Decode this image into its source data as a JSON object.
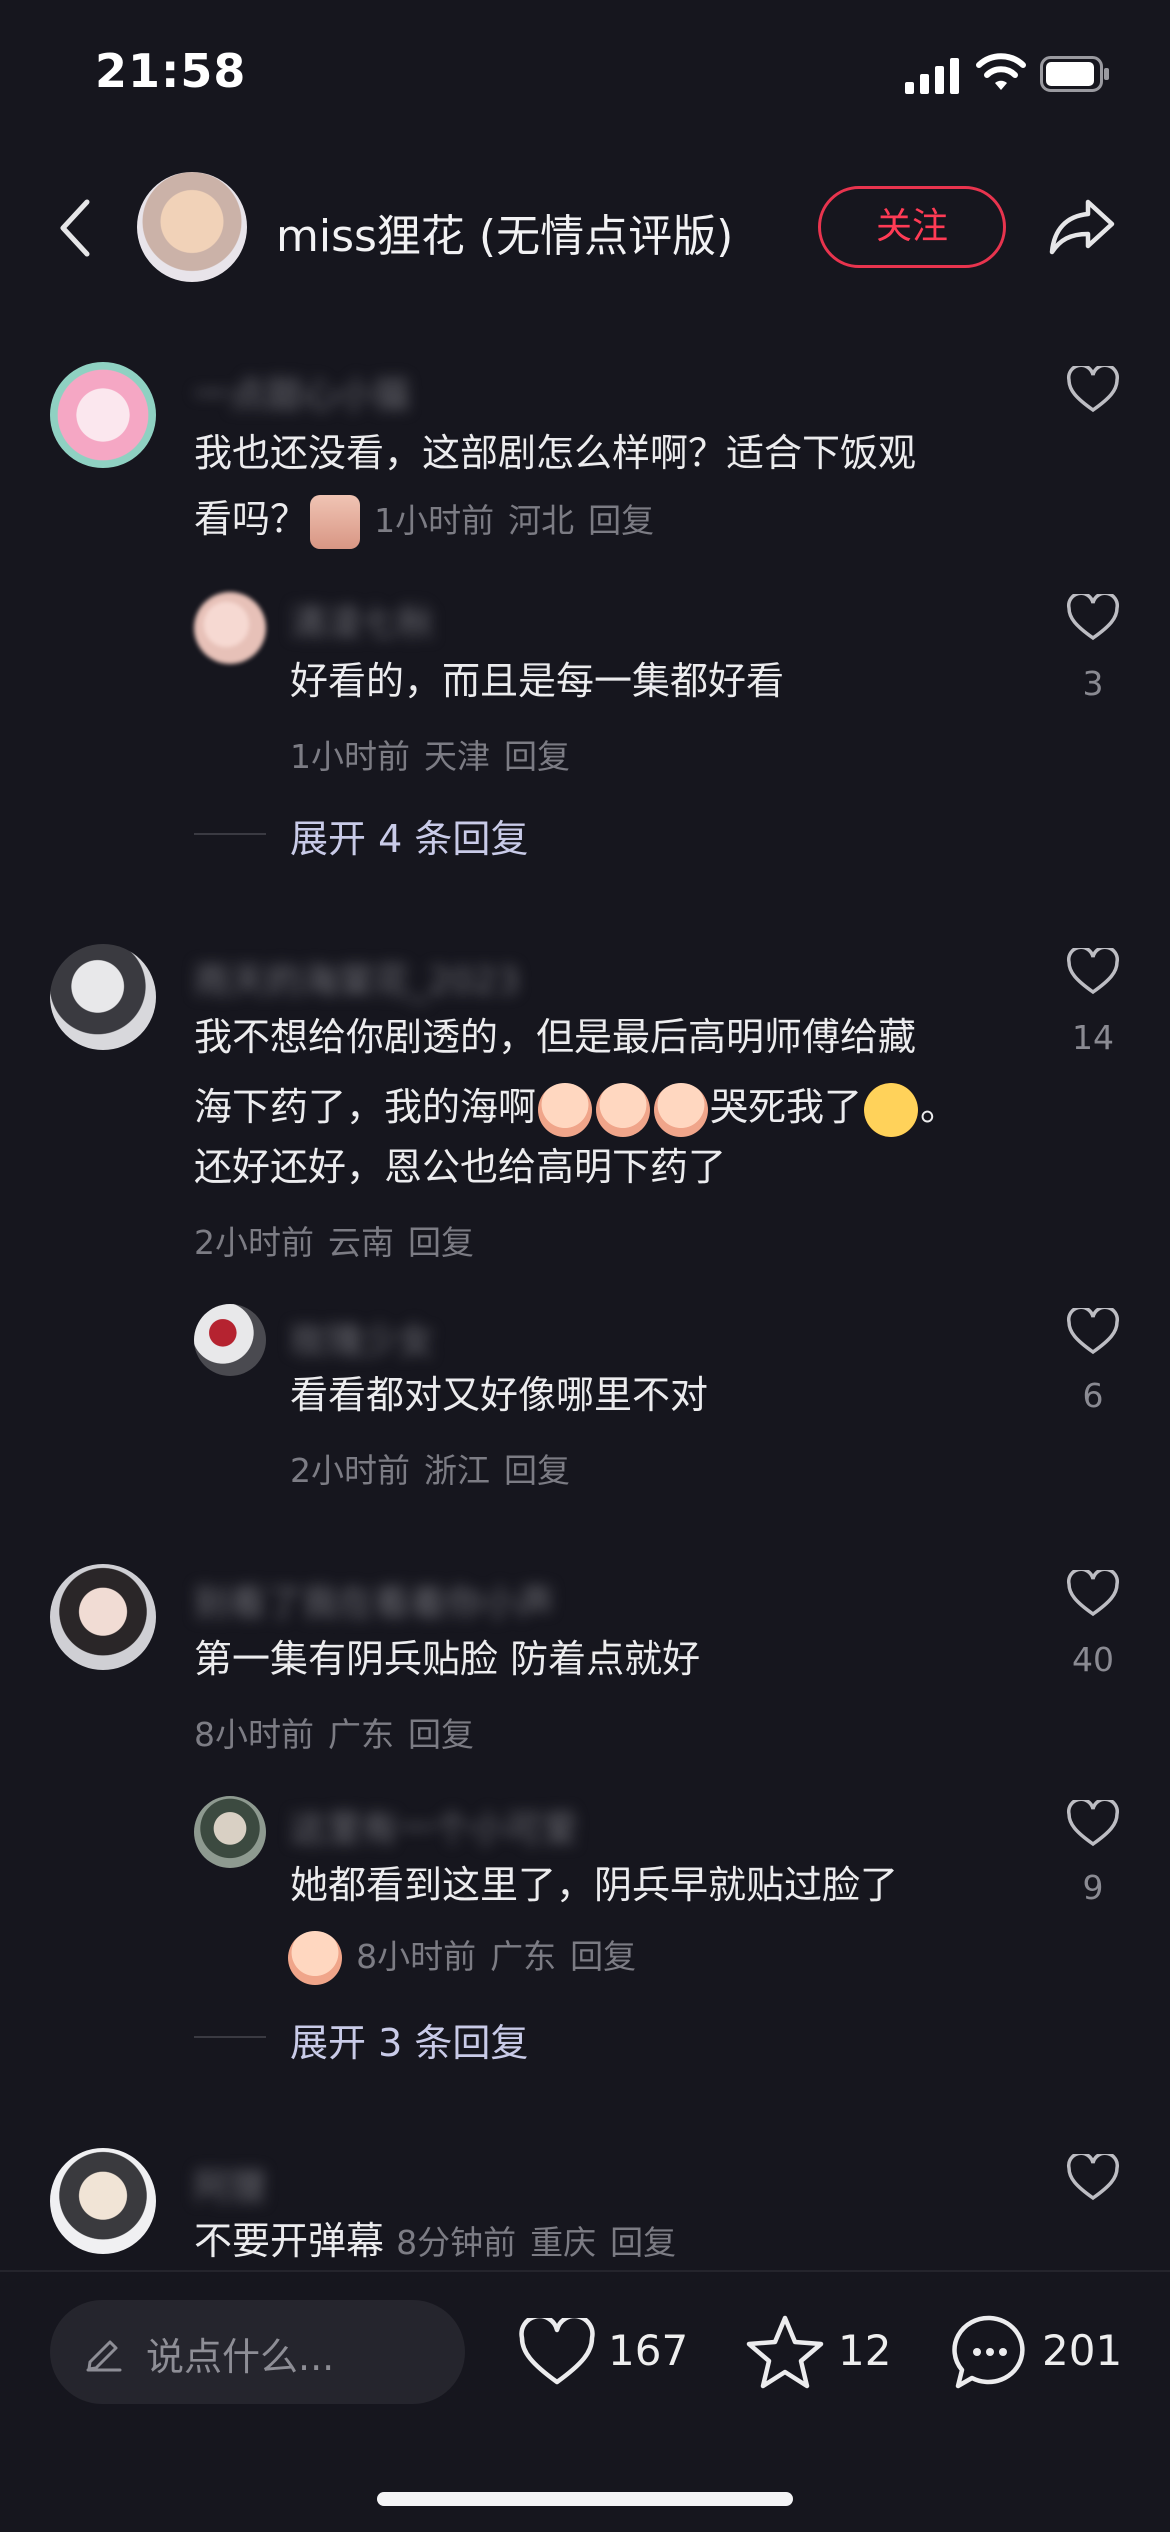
{
  "status": {
    "time": "21:58"
  },
  "header": {
    "title": "miss狸花 (无情点评版)",
    "follow_label": "关注"
  },
  "comments": [
    {
      "username": "一点甜心小猫",
      "text_lines": [
        "我也还没看，这部剧怎么样啊？适合下饭观",
        "看吗？"
      ],
      "time": "1小时前",
      "location": "河北",
      "reply": "回复",
      "likes": "",
      "reply_items": [
        {
          "username": "清凌七秋",
          "text": "好看的，而且是每一集都好看",
          "time": "1小时前",
          "location": "天津",
          "reply": "回复",
          "likes": "3"
        }
      ],
      "expand": "展开 4 条回复"
    },
    {
      "username": "雨天的海棠花_2023",
      "text_lines": [
        "我不想给你剧透的，但是最后高明师傅给藏",
        "海下药了，我的海啊",
        "哭死我了",
        "。",
        "还好还好，恩公也给高明下药了"
      ],
      "time": "2小时前",
      "location": "云南",
      "reply": "回复",
      "likes": "14",
      "reply_items": [
        {
          "username": "玫瑰少女",
          "text": "看看都对又好像哪里不对",
          "time": "2小时前",
          "location": "浙江",
          "reply": "回复",
          "likes": "6"
        }
      ]
    },
    {
      "username": "别看了我在看着你小声",
      "text_lines": [
        "第一集有阴兵贴脸 防着点就好"
      ],
      "time": "8小时前",
      "location": "广东",
      "reply": "回复",
      "likes": "40",
      "reply_items": [
        {
          "username": "这里有一个小可爱",
          "text": "她都看到这里了，阴兵早就贴过脸了",
          "time": "8小时前",
          "location": "广东",
          "reply": "回复",
          "likes": "9"
        }
      ],
      "expand": "展开 3 条回复"
    },
    {
      "username": "阿狸",
      "text_lines": [
        "不要开弹幕"
      ],
      "time": "8分钟前",
      "location": "重庆",
      "reply": "回复",
      "likes": ""
    }
  ],
  "bottom": {
    "input_placeholder": "说点什么...",
    "likes": "167",
    "favorites": "12",
    "comments": "201"
  },
  "icons": [
    "back-icon",
    "share-icon",
    "heart-icon",
    "star-icon",
    "chat-icon",
    "pencil-icon"
  ],
  "colors": {
    "background": "#16161e",
    "accent": "#e8344e"
  }
}
